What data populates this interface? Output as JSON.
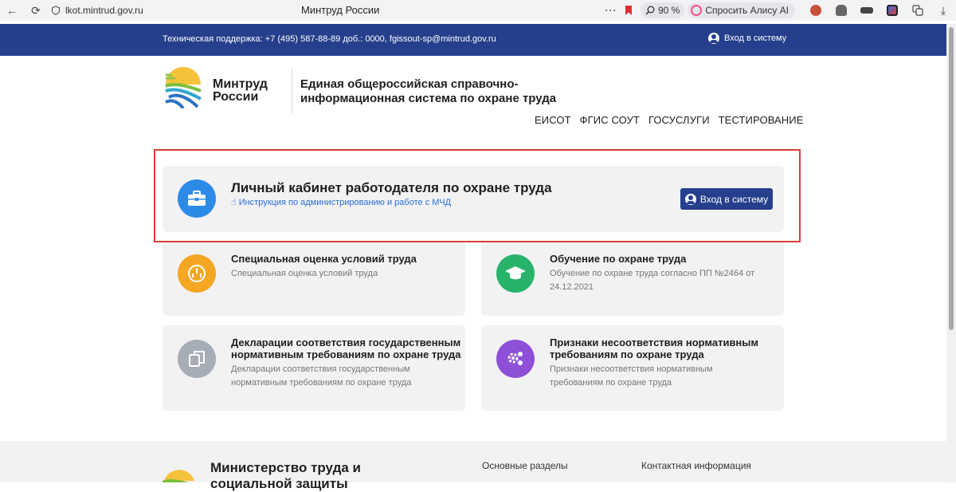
{
  "browser": {
    "back": "←",
    "reload": "⟳",
    "url": "lkot.mintrud.gov.ru",
    "tab_title": "Минтруд России",
    "menu_dots": "···",
    "zoom": "90 %",
    "alice": "Спросить Алису AI",
    "download": "⤓"
  },
  "support": {
    "text": "Техническая поддержка: +7 (495) 587-88-89 доб.: 0000, fgissout-sp@mintrud.gov.ru",
    "login": "Вход в систему"
  },
  "header": {
    "brand_line1": "Минтруд",
    "brand_line2": "России",
    "system_title": "Единая общероссийская справочно-информационная система по охране труда",
    "nav": [
      "ЕИСОТ",
      "ФГИС СОУТ",
      "ГОСУСЛУГИ",
      "ТЕСТИРОВАНИЕ"
    ]
  },
  "main_card": {
    "title": "Личный кабинет работодателя по охране труда",
    "link": "Инструкция по администрированию и работе с МЧД",
    "login_button": "Вход в систему"
  },
  "cards": [
    {
      "title": "Специальная оценка условий труда",
      "desc": "Специальная оценка условий труда",
      "color": "#f5a623"
    },
    {
      "title": "Обучение по охране труда",
      "desc": "Обучение по охране труда согласно ПП №2464 от 24.12.2021",
      "color": "#27b36a"
    },
    {
      "title": "Декларации соответствия государственным нормативным требованиям по охране труда",
      "desc": "Декларации соответствия государственным нормативным требованиям по охране труда",
      "color": "#a7adb7"
    },
    {
      "title": "Признаки несоответствия нормативным требованиям по охране труда",
      "desc": "Признаки несоответствия нормативным требованиям по охране труда",
      "color": "#8e4fd9"
    }
  ],
  "footer": {
    "title": "Министерство труда и социальной защиты",
    "col1": "Основные разделы",
    "col2": "Контактная информация"
  },
  "colors": {
    "primary": "#253f8c",
    "link": "#2a6fd6",
    "highlight": "#d6403a"
  }
}
